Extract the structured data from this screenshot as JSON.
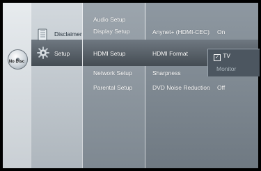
{
  "sidebar": {
    "disc_status": "No Disc",
    "items": [
      {
        "label": "Disclaimer",
        "icon": "disc-icon"
      },
      {
        "label": "Setup",
        "icon": "gear-icon",
        "selected": true
      }
    ]
  },
  "submenu": [
    {
      "label": "Audio Setup"
    },
    {
      "label": "Display Setup"
    },
    {
      "label": "HDMI Setup",
      "selected": true
    },
    {
      "label": "Network Setup"
    },
    {
      "label": "Parental Setup"
    }
  ],
  "settings": [
    {
      "label": "Anynet+ (HDMI-CEC)",
      "separator": ":",
      "value": "On"
    },
    {
      "label": "HDMI Format",
      "separator": "",
      "value": ""
    },
    {
      "label": "Sharpness",
      "separator": "",
      "value": ""
    },
    {
      "label": "DVD Noise Reduction",
      "separator": ":",
      "value": "Off"
    }
  ],
  "hdmi_format_popup": {
    "options": [
      "TV",
      "Monitor"
    ],
    "selected": "TV",
    "check_symbol": "✓"
  },
  "colors": {
    "highlight": "#4c5660",
    "text": "#ffffff",
    "dim_text": "#aab5bc"
  }
}
